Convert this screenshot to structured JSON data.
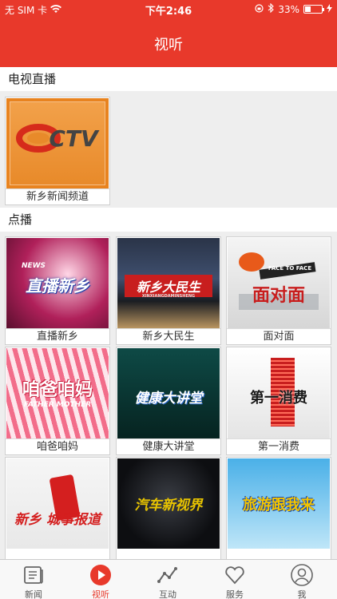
{
  "status_bar": {
    "carrier": "无 SIM 卡",
    "time": "下午2:46",
    "battery": "33%",
    "battery_level": 0.33
  },
  "header": {
    "title": "视听"
  },
  "live_section": {
    "title": "电视直播",
    "channels": [
      {
        "label": "新乡新闻频道",
        "logo_text": "CTV"
      }
    ]
  },
  "vod_section": {
    "title": "点播",
    "programs": [
      {
        "label": "直播新乡",
        "art_text": "直播新乡",
        "art_sub": "NEWS"
      },
      {
        "label": "新乡大民生",
        "art_text": "新乡大民生",
        "art_sub": "XINXIANGDAMINSHENG"
      },
      {
        "label": "面对面",
        "art_text": "面对面",
        "art_sub": "FACE TO FACE"
      },
      {
        "label": "咱爸咱妈",
        "art_text": "咱爸咱妈",
        "art_sub": "FATHER MOTHER"
      },
      {
        "label": "健康大讲堂",
        "art_text": "健康大讲堂",
        "art_sub": ""
      },
      {
        "label": "第一消费",
        "art_text": "第一消费",
        "art_sub": ""
      },
      {
        "label": "",
        "art_text": "新乡 城事报道",
        "art_sub": ""
      },
      {
        "label": "",
        "art_text": "汽车新视界",
        "art_sub": ""
      },
      {
        "label": "",
        "art_text": "旅游跟我来",
        "art_sub": ""
      }
    ]
  },
  "tab_bar": {
    "tabs": [
      {
        "label": "新闻",
        "icon": "news-icon"
      },
      {
        "label": "视听",
        "icon": "play-icon"
      },
      {
        "label": "互动",
        "icon": "interact-icon"
      },
      {
        "label": "服务",
        "icon": "heart-icon"
      },
      {
        "label": "我",
        "icon": "profile-icon"
      }
    ],
    "active": "视听"
  },
  "colors": {
    "brand": "#e8392b",
    "background": "#eeeeee"
  }
}
